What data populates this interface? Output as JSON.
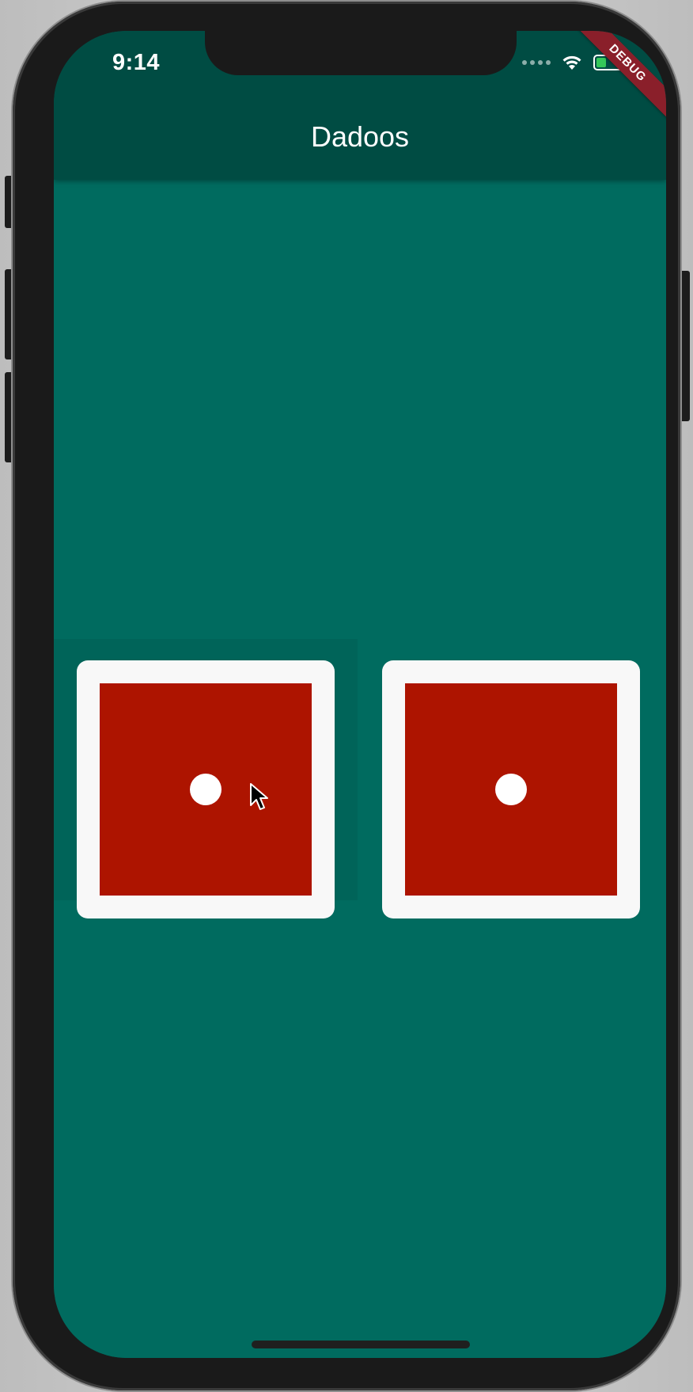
{
  "status_bar": {
    "time": "9:14",
    "icons": [
      "signal-dots-icon",
      "wifi-icon",
      "battery-charging-icon"
    ],
    "battery_color": "#34c759"
  },
  "app_bar": {
    "title": "Dadoos",
    "color": "#004c43"
  },
  "debug_banner": {
    "label": "DEBUG",
    "color": "#8a1f2a"
  },
  "body": {
    "background": "#006b5f"
  },
  "dice": [
    {
      "face_value": 1,
      "face_color": "#ad1400",
      "frame_color": "#f8f8f8"
    },
    {
      "face_value": 1,
      "face_color": "#ad1400",
      "frame_color": "#f8f8f8"
    }
  ]
}
